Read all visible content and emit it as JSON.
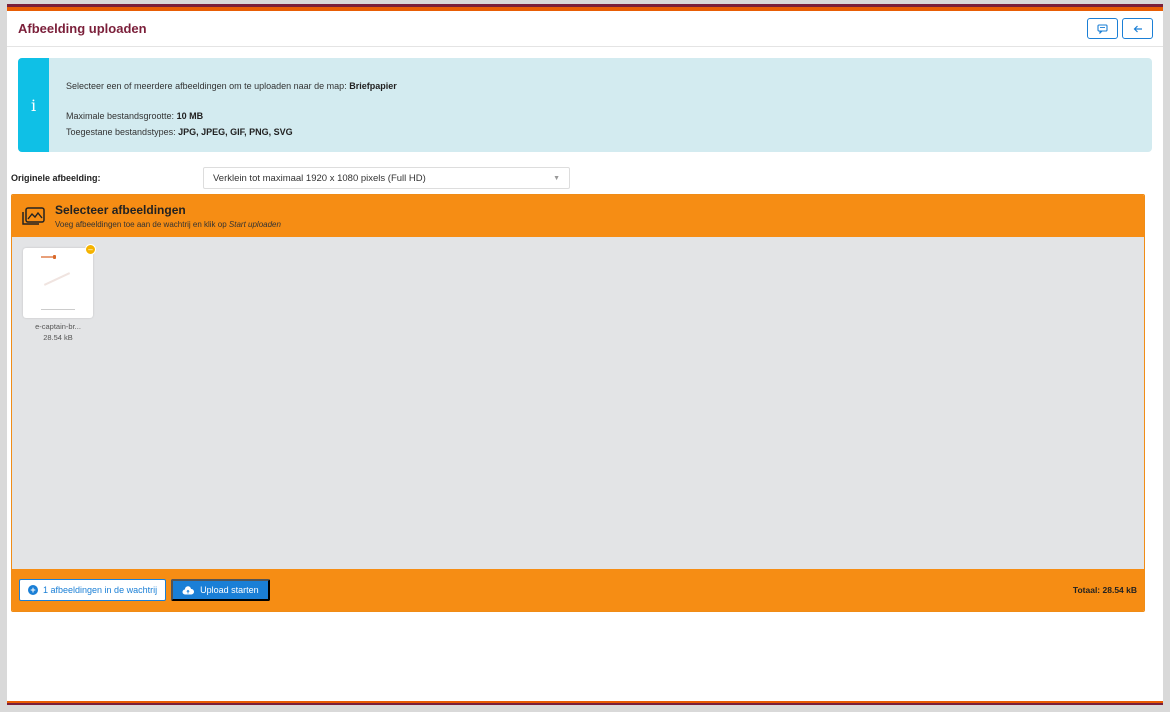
{
  "header": {
    "title": "Afbeelding uploaden",
    "actions": [
      {
        "icon": "comment-icon"
      },
      {
        "icon": "arrow-left-icon"
      }
    ]
  },
  "info": {
    "icon": "info-icon",
    "line1_prefix": "Selecteer een of meerdere afbeeldingen om te uploaden naar de map: ",
    "folder": "Briefpapier",
    "max_size_label": "Maximale bestandsgrootte: ",
    "max_size": "10 MB",
    "types_label": "Toegestane bestandstypes: ",
    "types": "JPG, JPEG, GIF, PNG, SVG"
  },
  "original": {
    "label": "Originele afbeelding:",
    "selected": "Verklein tot maximaal 1920 x 1080 pixels (Full HD)"
  },
  "uploader": {
    "title": "Selecteer afbeeldingen",
    "subtitle_prefix": "Voeg afbeeldingen toe aan de wachtrij en klik op ",
    "subtitle_emph": "Start uploaden",
    "files": [
      {
        "name": "e-captain-br...",
        "size": "28.54 kB"
      }
    ],
    "queue_button": "1 afbeeldingen in de wachtrij",
    "start_button": "Upload starten",
    "total": "Totaal: 28.54 kB"
  },
  "colors": {
    "accent_orange": "#f68d14",
    "title_maroon": "#7b1f3a",
    "primary_blue": "#1a7fd6",
    "info_bg": "#d3ebf0",
    "info_bar": "#0fc0e6"
  }
}
